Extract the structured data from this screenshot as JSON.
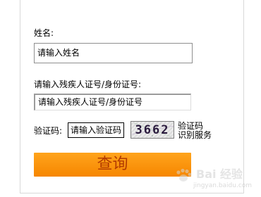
{
  "form": {
    "name_label": "姓名:",
    "name_placeholder": "请输入姓名",
    "id_label": "请输入残疾人证号/身份证号:",
    "id_placeholder": "请输入残疾人证号/身份证号",
    "captcha_label": "验证码:",
    "captcha_placeholder": "请输入验证码",
    "captcha_code": "3662",
    "captcha_help_line1": "验证码",
    "captcha_help_line2": "识别服务",
    "submit_label": "查询"
  },
  "watermark": {
    "text": "Bai 经验",
    "sub": "jingyan.baidu.com"
  },
  "colors": {
    "button_top": "#ffa41c",
    "button_bottom": "#f68600",
    "button_text": "#b23a00"
  }
}
